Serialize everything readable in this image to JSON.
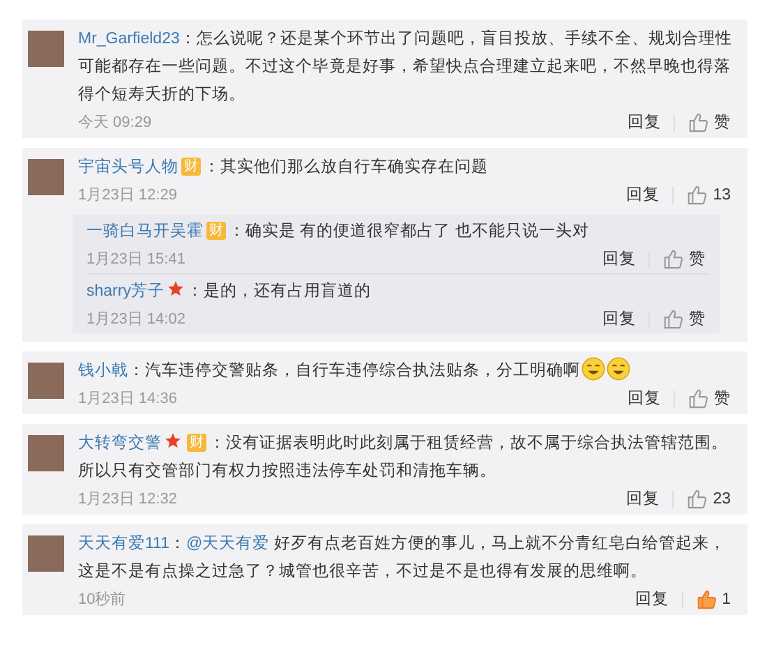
{
  "comments": [
    {
      "user": "Mr_Garfield23",
      "text": "：怎么说呢？还是某个环节出了问题吧，盲目投放、手续不全、规划合理性可能都存在一些问题。不过这个毕竟是好事，希望快点合理建立起来吧，不然早晚也得落得个短寿夭折的下场。",
      "time": "今天 09:29",
      "reply": "回复",
      "like": "赞",
      "liked": false
    },
    {
      "user": "宇宙头号人物",
      "badges": [
        {
          "kind": "wealth",
          "text": "财"
        }
      ],
      "text": "：其实他们那么放自行车确实存在问题",
      "time": "1月23日 12:29",
      "reply": "回复",
      "like": "13",
      "liked": false,
      "children": [
        {
          "user": "一骑白马开吴霍",
          "badges": [
            {
              "kind": "wealth",
              "text": "财"
            }
          ],
          "text": "：确实是 有的便道很窄都占了 也不能只说一头对",
          "time": "1月23日 15:41",
          "reply": "回复",
          "like": "赞",
          "liked": false
        },
        {
          "user": "sharry芳子",
          "badges": [
            {
              "kind": "star"
            }
          ],
          "text": "：是的，还有占用盲道的",
          "time": "1月23日 14:02",
          "reply": "回复",
          "like": "赞",
          "liked": false
        }
      ]
    },
    {
      "user": "钱小戟",
      "text": "：汽车违停交警贴条，自行车违停综合执法贴条，分工明确啊",
      "emoticons": [
        {
          "kind": "laugh"
        },
        {
          "kind": "laugh"
        }
      ],
      "time": "1月23日 14:36",
      "reply": "回复",
      "like": "赞",
      "liked": false
    },
    {
      "user": "大转弯交警",
      "badges": [
        {
          "kind": "star"
        },
        {
          "kind": "wealth",
          "text": "财"
        }
      ],
      "text": "：没有证据表明此时此刻属于租赁经营，故不属于综合执法管辖范围。所以只有交管部门有权力按照违法停车处罚和清拖车辆。",
      "time": "1月23日 12:32",
      "reply": "回复",
      "like": "23",
      "liked": false
    },
    {
      "user": "天天有爱111",
      "text": "：",
      "mention": "@天天有爱",
      "after": " 好歹有点老百姓方便的事儿，马上就不分青红皂白给管起来，这是不是有点操之过急了？城管也很辛苦，不过是不是也得有发展的思维啊。",
      "time": "10秒前",
      "reply": "回复",
      "like": "1",
      "liked": true
    }
  ]
}
